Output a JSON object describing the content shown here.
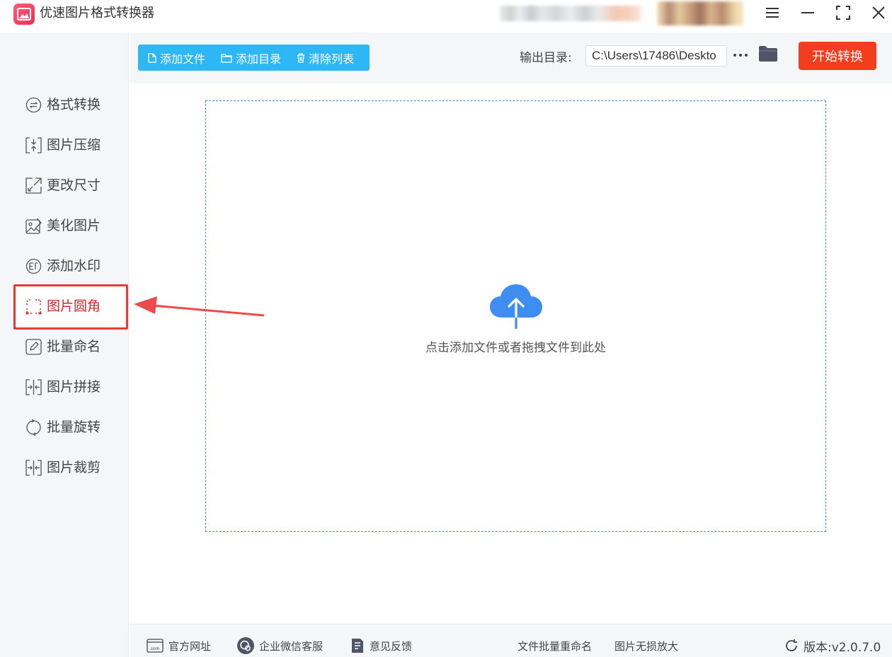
{
  "app": {
    "title": "优速图片格式转换器"
  },
  "sidebar": {
    "items": [
      {
        "label": "格式转换",
        "icon": "format-convert-icon"
      },
      {
        "label": "图片压缩",
        "icon": "compress-icon"
      },
      {
        "label": "更改尺寸",
        "icon": "resize-icon"
      },
      {
        "label": "美化图片",
        "icon": "beautify-icon"
      },
      {
        "label": "添加水印",
        "icon": "watermark-icon"
      },
      {
        "label": "图片圆角",
        "icon": "rounded-corner-icon",
        "active": true
      },
      {
        "label": "批量命名",
        "icon": "rename-icon"
      },
      {
        "label": "图片拼接",
        "icon": "stitch-icon"
      },
      {
        "label": "批量旋转",
        "icon": "rotate-icon"
      },
      {
        "label": "图片裁剪",
        "icon": "crop-icon"
      }
    ]
  },
  "toolbar": {
    "add_file": "添加文件",
    "add_folder": "添加目录",
    "clear_list": "清除列表",
    "output_label": "输出目录:",
    "output_path": "C:\\Users\\17486\\Deskto",
    "more": "···",
    "start": "开始转换"
  },
  "main": {
    "drop_text": "点击添加文件或者拖拽文件到此处"
  },
  "footer": {
    "website": "官方网址",
    "wechat": "企业微信客服",
    "feedback": "意见反馈",
    "batch_rename": "文件批量重命名",
    "upscale": "图片无损放大",
    "version": "版本:v2.0.7.0"
  },
  "colors": {
    "accent_blue": "#2db7f5",
    "start_red": "#f33d1f",
    "active_red": "#d52828",
    "annotation_red": "#e43c3c",
    "cloud_blue": "#3d8ef0"
  }
}
